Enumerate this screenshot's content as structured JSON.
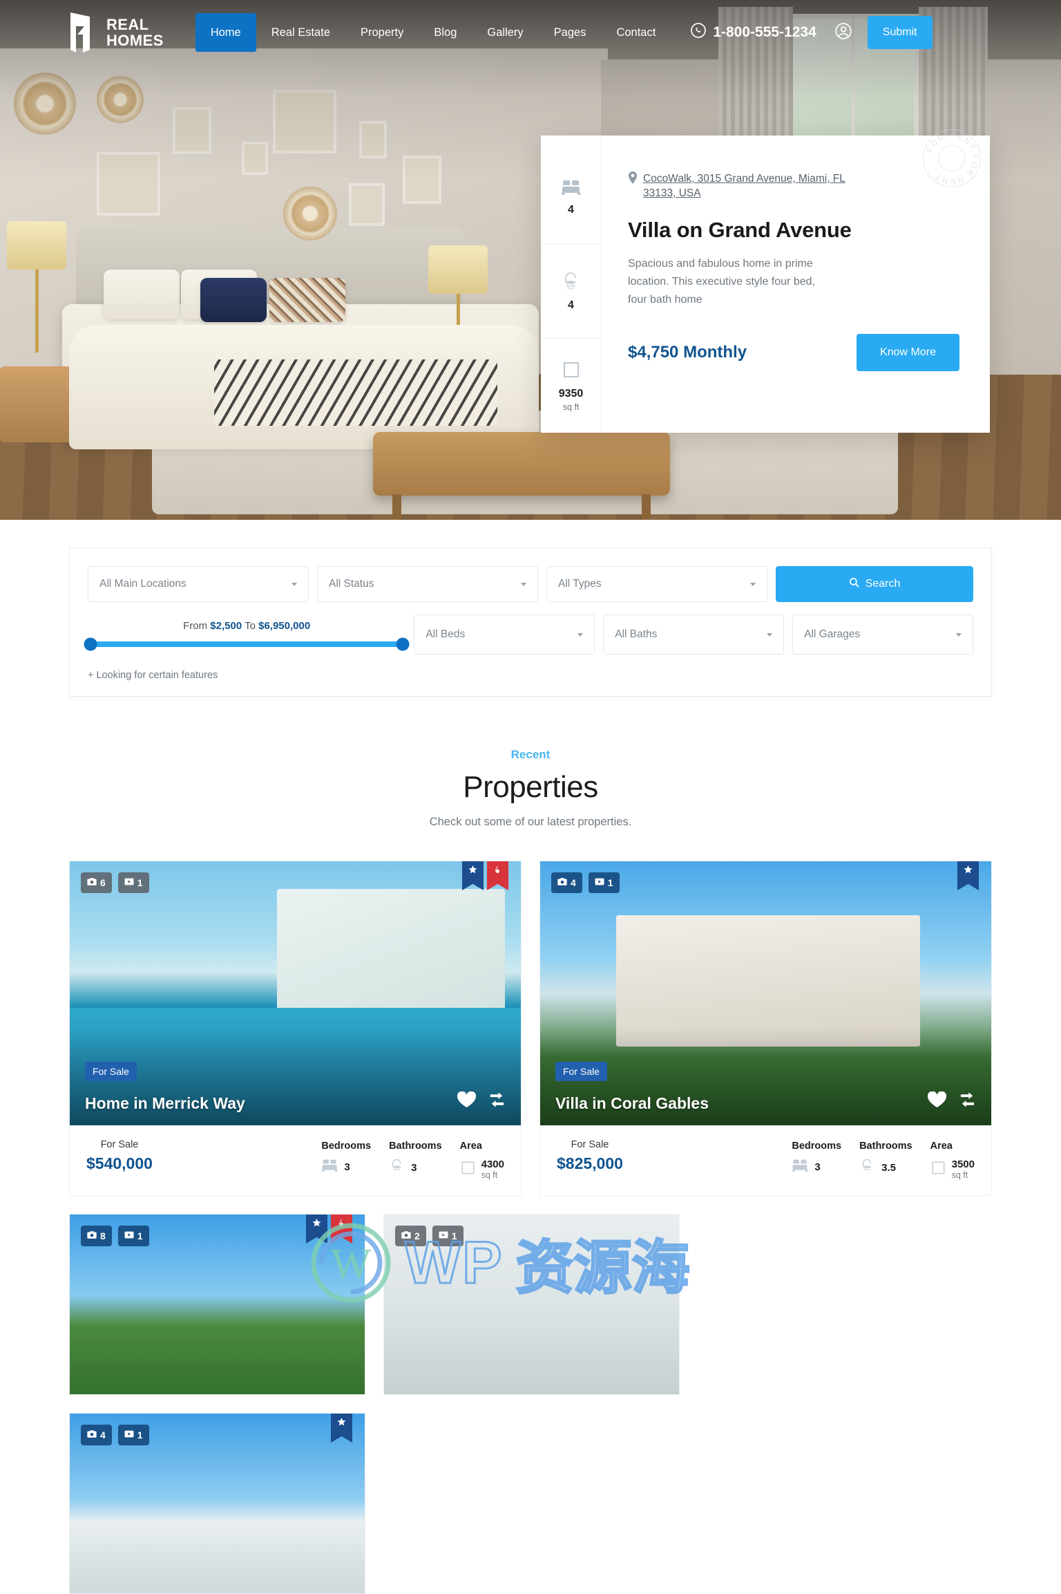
{
  "header": {
    "logo": {
      "line1": "REAL",
      "line2": "HOMES",
      "icon": "real-homes-logo-icon"
    },
    "nav": [
      {
        "label": "Home",
        "active": true
      },
      {
        "label": "Real Estate",
        "active": false
      },
      {
        "label": "Property",
        "active": false
      },
      {
        "label": "Blog",
        "active": false
      },
      {
        "label": "Gallery",
        "active": false
      },
      {
        "label": "Pages",
        "active": false
      },
      {
        "label": "Contact",
        "active": false
      }
    ],
    "phone": "1-800-555-1234",
    "phone_icon": "whatsapp-icon",
    "user_icon": "user-account-icon",
    "submit_label": "Submit"
  },
  "hero_card": {
    "stats": [
      {
        "icon": "bed-icon",
        "value": "4",
        "unit": ""
      },
      {
        "icon": "shower-icon",
        "value": "4",
        "unit": ""
      },
      {
        "icon": "area-icon",
        "value": "9350",
        "unit": "sq ft"
      }
    ],
    "address": "CocoWalk, 3015 Grand Avenue, Miami, FL 33133, USA",
    "address_icon": "map-pin-icon",
    "title": "Villa on Grand Avenue",
    "description": "Spacious and fabulous home in prime location. This executive style four bed, four bath home",
    "price": "$4,750 Monthly",
    "cta_label": "Know More",
    "seal_text": "FOR RENT"
  },
  "search": {
    "location": "All Main Locations",
    "status": "All Status",
    "types": "All Types",
    "search_label": "Search",
    "search_icon": "search-icon",
    "price_prefix": "From",
    "price_min": "$2,500",
    "price_middle": "To",
    "price_max": "$6,950,000",
    "beds": "All Beds",
    "baths": "All Baths",
    "garages": "All Garages",
    "features_toggle": "+ Looking for certain features"
  },
  "properties_section": {
    "eyebrow": "Recent",
    "title": "Properties",
    "subtitle": "Check out some of our latest properties."
  },
  "property_cards": [
    {
      "photos": "6",
      "videos": "1",
      "ribbons": [
        "star",
        "hot"
      ],
      "status_tag": "For Sale",
      "title": "Home in Merrick Way",
      "foot_label": "For Sale",
      "price": "$540,000",
      "beds_header": "Bedrooms",
      "beds": "3",
      "baths_header": "Bathrooms",
      "baths": "3",
      "area_header": "Area",
      "area": "4300",
      "area_unit": "sq ft",
      "badge_style": "grey"
    },
    {
      "photos": "4",
      "videos": "1",
      "ribbons": [
        "star"
      ],
      "status_tag": "For Sale",
      "title": "Villa in Coral Gables",
      "foot_label": "For Sale",
      "price": "$825,000",
      "beds_header": "Bedrooms",
      "beds": "3",
      "baths_header": "Bathrooms",
      "baths": "3.5",
      "area_header": "Area",
      "area": "3500",
      "area_unit": "sq ft",
      "badge_style": "blue"
    }
  ],
  "property_cards_row2": [
    {
      "photos": "8",
      "videos": "1",
      "ribbons": [
        "star",
        "hot"
      ],
      "badge_style": "blue"
    },
    {
      "photos": "2",
      "videos": "1",
      "ribbons": [],
      "badge_style": "grey"
    },
    {
      "photos": "4",
      "videos": "1",
      "ribbons": [
        "star"
      ],
      "badge_style": "blue"
    }
  ],
  "watermark": {
    "text": "WP",
    "cn": "资源海"
  },
  "colors": {
    "primary": "#29aaf2",
    "nav_active": "#0d71c4",
    "price": "#11548f",
    "eyebrow": "#49b6f0",
    "tag": "#2160ad",
    "ribbon_star": "#1b4d8f",
    "ribbon_hot": "#d8343c"
  }
}
